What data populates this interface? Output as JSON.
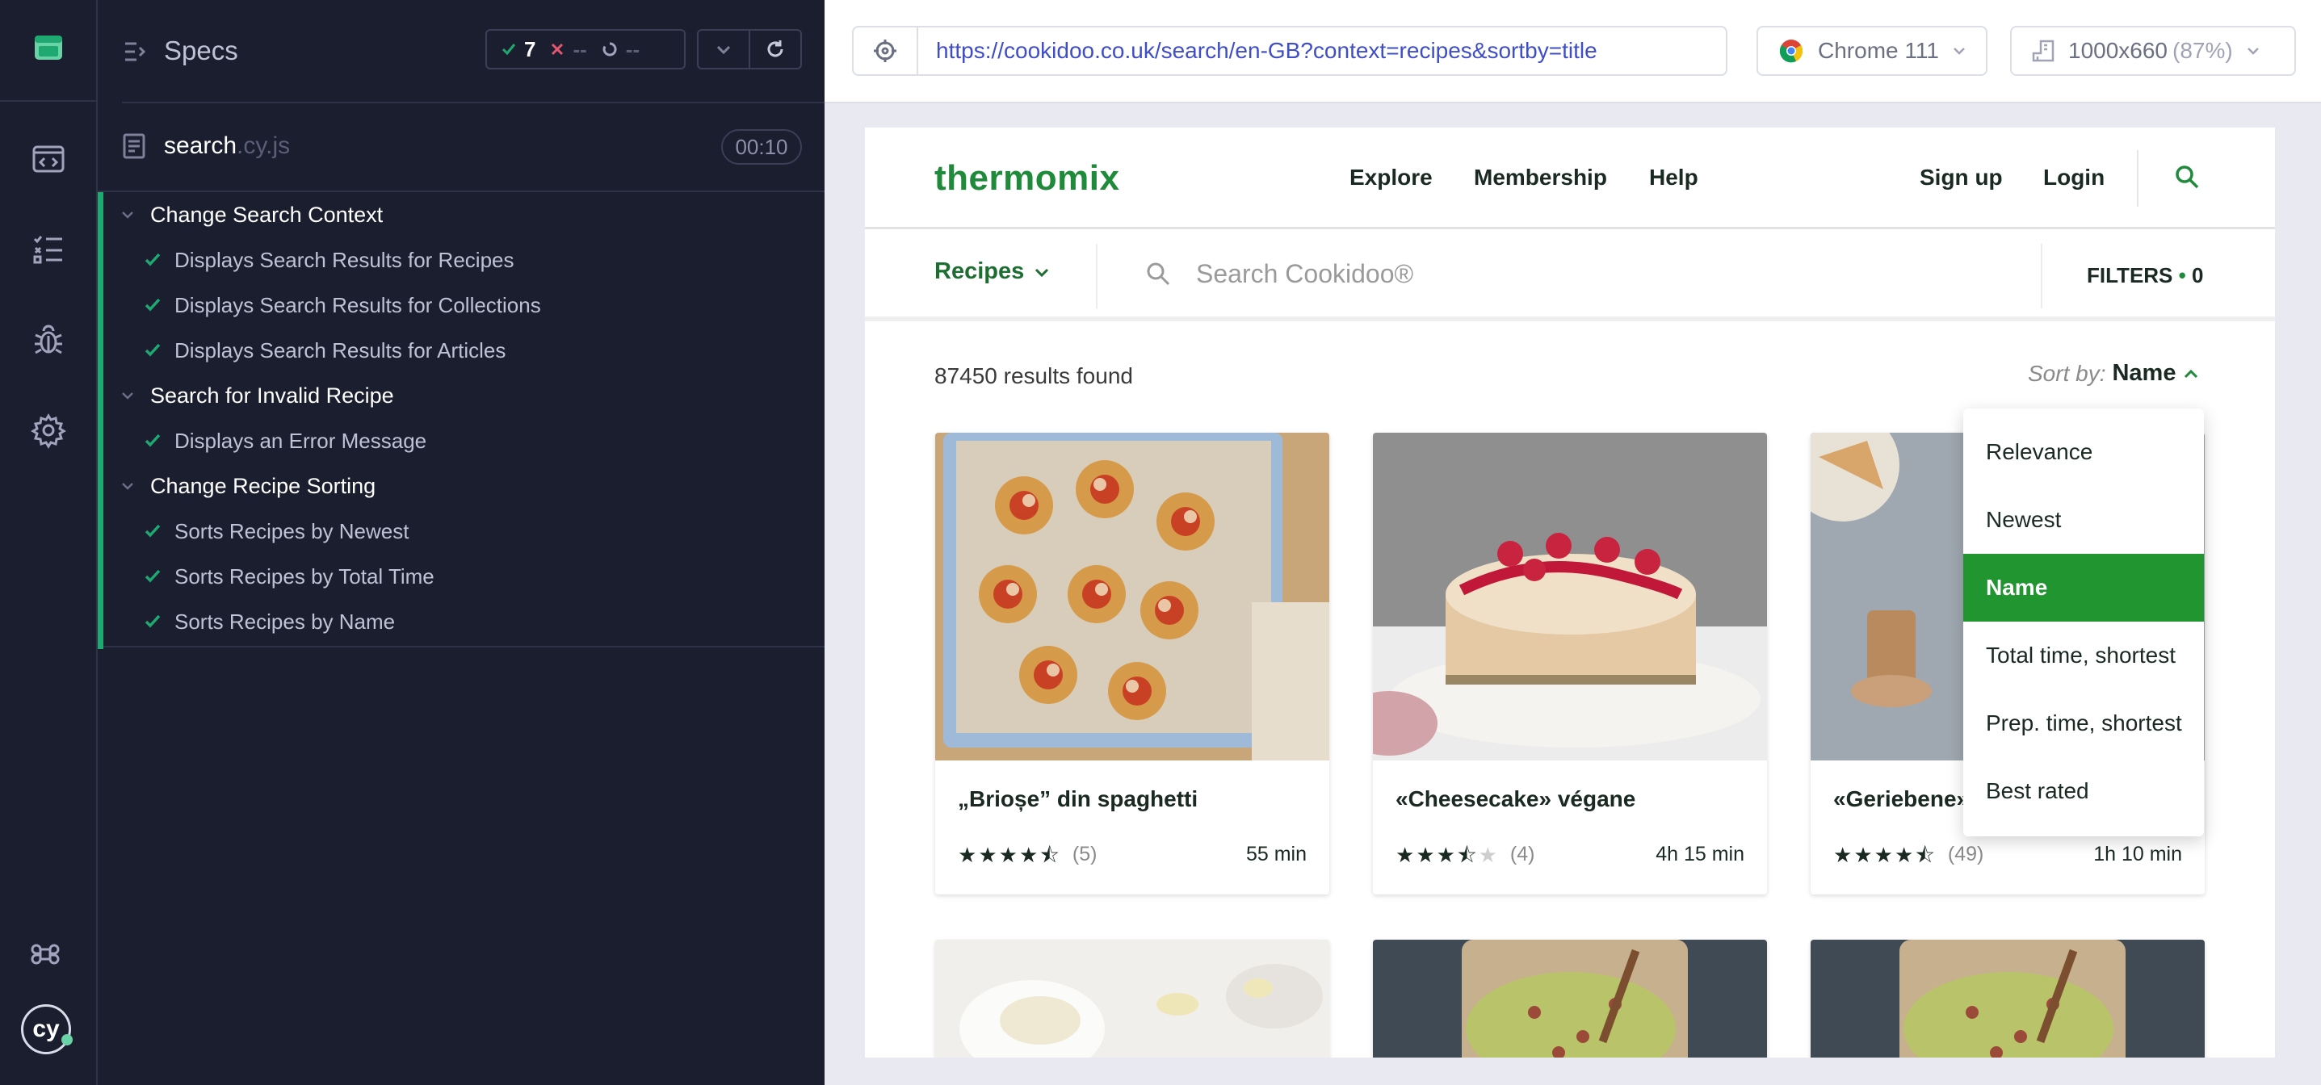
{
  "specs": {
    "title": "Specs",
    "stats": {
      "passed": "7",
      "failed": "--",
      "pending": "--"
    },
    "file": {
      "name": "search",
      "ext": ".cy.js",
      "duration": "00:10"
    },
    "suites": [
      {
        "label": "Change Search Context",
        "tests": [
          "Displays Search Results for Recipes",
          "Displays Search Results for Collections",
          "Displays Search Results for Articles"
        ]
      },
      {
        "label": "Search for Invalid Recipe",
        "tests": [
          "Displays an Error Message"
        ]
      },
      {
        "label": "Change Recipe Sorting",
        "tests": [
          "Sorts Recipes by Newest",
          "Sorts Recipes by Total Time",
          "Sorts Recipes by Name"
        ]
      }
    ]
  },
  "toolbar": {
    "url": "https://cookidoo.co.uk/search/en-GB?context=recipes&sortby=title",
    "browser": "Chrome 111",
    "viewport": "1000x660",
    "zoom": "(87%)"
  },
  "site": {
    "logo": "thermomix",
    "nav": [
      "Explore",
      "Membership",
      "Help"
    ],
    "sign_up": "Sign up",
    "login": "Login",
    "context": "Recipes",
    "search_placeholder": "Search Cookidoo®",
    "filters_label": "FILTERS",
    "filters_dot": "•",
    "filters_count": "0",
    "results": "87450 results found",
    "sort_label": "Sort by:",
    "sort_value": "Name",
    "sort_options": [
      "Relevance",
      "Newest",
      "Name",
      "Total time, shortest",
      "Prep. time, shortest",
      "Best rated"
    ],
    "sort_active": 2,
    "recipes": [
      {
        "title": "„Brioșe” din spaghetti",
        "rating": 4.5,
        "count": "(5)",
        "time": "55 min"
      },
      {
        "title": "«Cheesecake» végane",
        "rating": 3.5,
        "count": "(4)",
        "time": "4h 15 min"
      },
      {
        "title": "«Geriebene»",
        "rating": 4.5,
        "count": "(49)",
        "time": "1h 10 min"
      }
    ]
  },
  "colors": {
    "brand_green": "#21952f",
    "pass_green": "#1fa971",
    "fail_red": "#e45770",
    "sidebar_bg": "#1b1e2e"
  }
}
